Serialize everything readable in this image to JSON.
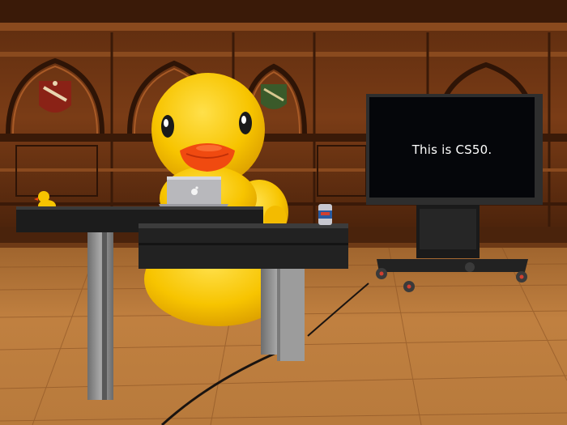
{
  "screen": {
    "text": "This is CS50."
  },
  "colors": {
    "wood_wall": "#6b3414",
    "wood_dark": "#3a1a08",
    "floor": "#b8763a",
    "duck_yellow": "#f7c400",
    "duck_beak": "#f04a10",
    "desk_top": "#1c1c1c",
    "desk_leg": "#8a8a8a",
    "monitor_bezel": "#2e2e2e",
    "monitor_screen": "#05060a"
  },
  "icons": {
    "laptop_logo": "apple-logo-icon"
  }
}
